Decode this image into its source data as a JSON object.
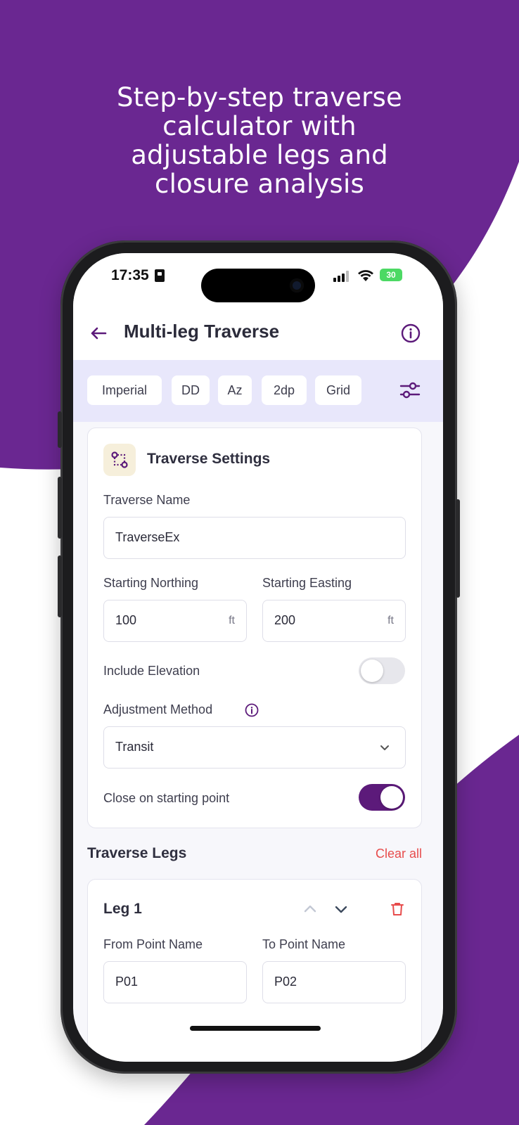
{
  "headline": {
    "line1": "Step-by-step traverse",
    "line2": "calculator with",
    "line3": "adjustable legs and",
    "line4": "closure analysis"
  },
  "colors": {
    "brand_purple": "#6a2791",
    "toggle_on": "#5c1a7a",
    "chipbar_bg": "#e8e7fb",
    "danger": "#e74c4c"
  },
  "status_bar": {
    "time": "17:35",
    "battery": "30"
  },
  "appbar": {
    "title": "Multi-leg Traverse"
  },
  "chips": [
    "Imperial",
    "DD",
    "Az",
    "2dp",
    "Grid"
  ],
  "settings": {
    "title": "Traverse Settings",
    "traverse_name_label": "Traverse Name",
    "traverse_name_value": "TraverseEx",
    "starting_northing_label": "Starting Northing",
    "starting_northing_value": "100",
    "starting_easting_label": "Starting Easting",
    "starting_easting_value": "200",
    "unit": "ft",
    "include_elevation_label": "Include Elevation",
    "include_elevation_on": false,
    "adjustment_method_label": "Adjustment Method",
    "adjustment_method_value": "Transit",
    "close_on_start_label": "Close on starting point",
    "close_on_start_on": true
  },
  "legs": {
    "section_title": "Traverse Legs",
    "clear_all": "Clear all",
    "items": [
      {
        "title": "Leg 1",
        "from_label": "From Point Name",
        "from_value": "P01",
        "to_label": "To Point Name",
        "to_value": "P02"
      }
    ]
  }
}
